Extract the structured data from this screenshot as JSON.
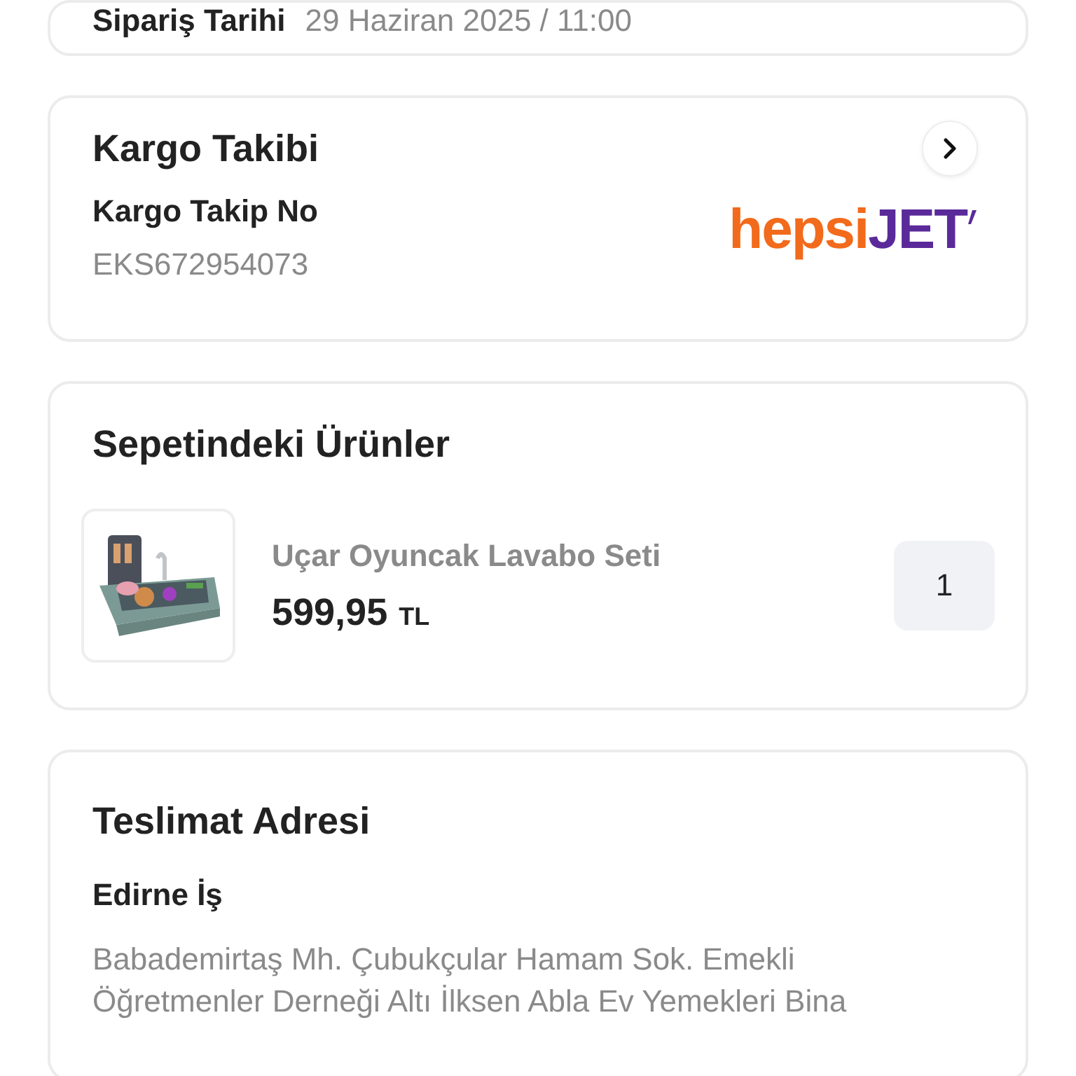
{
  "order_date": {
    "label": "Sipariş Tarihi",
    "value": "29 Haziran 2025 / 11:00"
  },
  "cargo": {
    "title": "Kargo Takibi",
    "tracking_label": "Kargo Takip No",
    "tracking_number": "EKS672954073",
    "carrier_logo": {
      "part_1": "hepsi",
      "part_2": "JET"
    }
  },
  "basket": {
    "title": "Sepetindeki Ürünler",
    "items": [
      {
        "name": "Uçar Oyuncak Lavabo Seti",
        "price": "599,95",
        "currency": "TL",
        "quantity": "1"
      }
    ]
  },
  "delivery": {
    "title": "Teslimat Adresi",
    "address_name": "Edirne İş",
    "address_lines": [
      "Babademirtaş Mh. Çubukçular Hamam Sok. Emekli",
      "Öğretmenler Derneği Altı İlksen Abla Ev Yemekleri Bina"
    ]
  }
}
